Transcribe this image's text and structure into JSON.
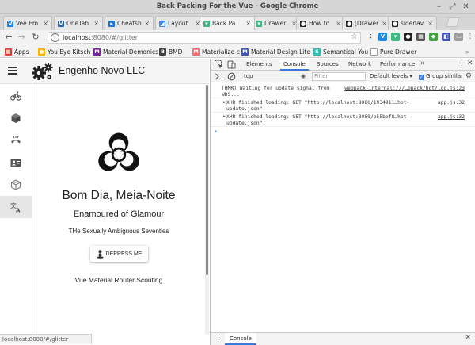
{
  "window": {
    "title": "Back Packing For the Vue - Google Chrome"
  },
  "tabs": [
    {
      "label": "Vee Em",
      "icon": "vee-validate-icon",
      "color": "#1e88e5",
      "active": false
    },
    {
      "label": "OneTab",
      "icon": "onetab-icon",
      "color": "#2f5fa3",
      "active": false
    },
    {
      "label": "Cheatsh",
      "icon": "cheatsheet-icon",
      "color": "#1976d2",
      "active": false
    },
    {
      "label": "Layout",
      "icon": "layout-icon",
      "color": "#4285f4",
      "active": false
    },
    {
      "label": "Back Pa",
      "icon": "vue-icon",
      "color": "#41b883",
      "active": true
    },
    {
      "label": "Drawer",
      "icon": "vue-icon",
      "color": "#41b883",
      "active": false
    },
    {
      "label": "How to",
      "icon": "github-icon",
      "color": "#222222",
      "active": false
    },
    {
      "label": "[Drawer",
      "icon": "github-icon",
      "color": "#222222",
      "active": false
    },
    {
      "label": "sidenav",
      "icon": "github-icon",
      "color": "#222222",
      "active": false
    }
  ],
  "toolbar": {
    "url_host": "localhost",
    "url_path": ":8080/#/glitter"
  },
  "bookmarks": [
    {
      "label": "Apps",
      "icon": "apps-icon",
      "color": "#e53935"
    },
    {
      "label": "You Eye Kitsch",
      "icon": "kitsch-icon",
      "color": "#ffb300"
    },
    {
      "label": "Material Demonics",
      "icon": "material-icon",
      "color": "#7b1fa2"
    },
    {
      "label": "BMD",
      "icon": "bmd-icon",
      "color": "#424242"
    },
    {
      "label": "Materialize-c",
      "icon": "materialize-icon",
      "color": "#ee6e73"
    },
    {
      "label": "Material Design Lite",
      "icon": "mdl-icon",
      "color": "#3f51b5"
    },
    {
      "label": "Semantical You",
      "icon": "semantic-icon",
      "color": "#35bdb2"
    },
    {
      "label": "Pure Drawer",
      "icon": "page-icon",
      "color": "#9e9e9e"
    }
  ],
  "app": {
    "title": "Engenho Novo LLC",
    "greeting": "Bom Dia, Meia-Noite",
    "subtitle": "Enamoured of Glamour",
    "tagline": "THe Sexually Ambiguous Seventies",
    "button_label": "DEPRESS ME",
    "router_label": "Vue Material Router Scouting",
    "sidenav": [
      {
        "name": "bike-icon"
      },
      {
        "name": "cube-icon"
      },
      {
        "name": "phone-hangup-icon"
      },
      {
        "name": "contact-card-icon"
      },
      {
        "name": "box-outline-icon"
      },
      {
        "name": "translate-icon"
      }
    ]
  },
  "status": {
    "url": "localhost:8080/#/glitter"
  },
  "devtools": {
    "tabs": [
      "Elements",
      "Console",
      "Sources",
      "Network",
      "Performance"
    ],
    "active_tab": "Console",
    "more": "»",
    "context": "top",
    "filter_placeholder": "Filter",
    "levels": "Default levels ▾",
    "group_similar": "Group similar",
    "messages": [
      {
        "text": "[HMR] Waiting for update signal from WDS...",
        "source": "webpack-internal:///…bpack/hot/log.js:23"
      },
      {
        "text": "XHR finished loading: GET \"http://localhost:8080/1934911…hot-update.json\".",
        "source": "app.js:32"
      },
      {
        "text": "XHR finished loading: GET \"http://localhost:8080/b55bef8…hot-update.json\".",
        "source": "app.js:32"
      }
    ],
    "drawer_tab": "Console"
  },
  "colors": {
    "accent": "#3879d9",
    "vue_green": "#41b883"
  }
}
